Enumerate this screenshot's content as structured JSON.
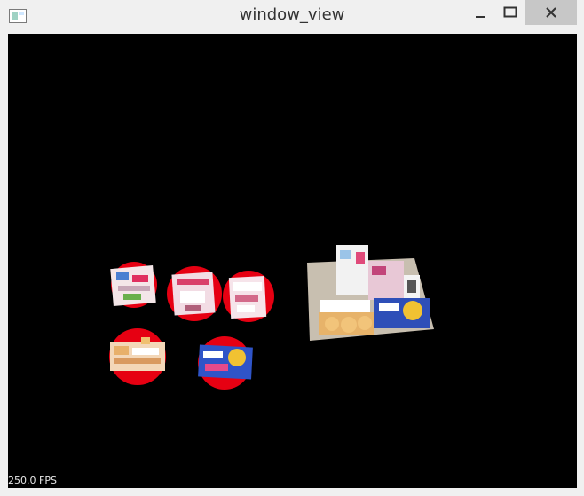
{
  "window": {
    "title": "window_view"
  },
  "viewport": {
    "fps_text": "250.0 FPS"
  },
  "icons": {
    "app": "window-icon",
    "minimize": "minimize-icon",
    "maximize": "maximize-icon",
    "close": "close-icon"
  },
  "colors": {
    "viewport_background": "#000000",
    "marker": "#e60012",
    "close_button": "#c7c7c7"
  }
}
